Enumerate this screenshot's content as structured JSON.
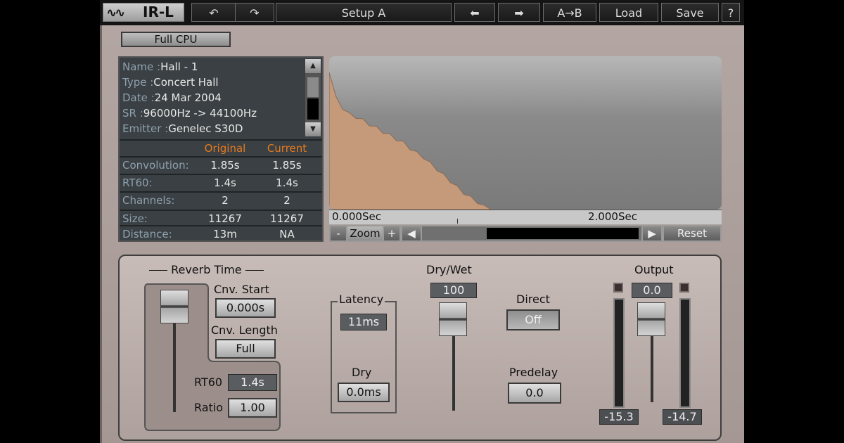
{
  "toolbar": {
    "logo_text": "IR-L",
    "setup_name": "Setup A",
    "ab_label": "A→B",
    "load_label": "Load",
    "save_label": "Save",
    "help_label": "?",
    "undo_icon": "undo-icon",
    "redo_icon": "redo-icon",
    "prev_icon": "arrow-left-icon",
    "next_icon": "arrow-right-icon"
  },
  "cpu_mode": "Full CPU",
  "ir_info": {
    "name_label": "Name :",
    "name": "Hall - 1",
    "type_label": "Type :",
    "type": "Concert Hall",
    "date_label": "Date :",
    "date": "24 Mar 2004",
    "sr_label": "SR :",
    "sr": "96000Hz -> 44100Hz",
    "emitter_label": "Emitter :",
    "emitter": "Genelec S30D"
  },
  "stats": {
    "col_original": "Original",
    "col_current": "Current",
    "rows": [
      {
        "label": "Convolution:",
        "original": "1.85s",
        "current": "1.85s"
      },
      {
        "label": "RT60:",
        "original": "1.4s",
        "current": "1.4s"
      },
      {
        "label": "Channels:",
        "original": "2",
        "current": "2"
      },
      {
        "label": "Size:",
        "original": "11267",
        "current": "11267"
      },
      {
        "label": "Distance:",
        "original": "13m",
        "current": "NA"
      }
    ]
  },
  "graph": {
    "axis_start": "0.000Sec",
    "axis_mid": "2.000Sec",
    "zoom_minus": "-",
    "zoom_label": "Zoom",
    "zoom_plus": "+",
    "reset_label": "Reset",
    "fill_color": "#c49a7a",
    "envelope": [
      0.92,
      0.75,
      0.68,
      0.64,
      0.62,
      0.6,
      0.57,
      0.55,
      0.52,
      0.5,
      0.47,
      0.45,
      0.41,
      0.38,
      0.35,
      0.31,
      0.27,
      0.23,
      0.19,
      0.15,
      0.11,
      0.08,
      0.05,
      0.02,
      0.0
    ]
  },
  "controls": {
    "reverb_time_label": "Reverb Time",
    "cnv_start_label": "Cnv. Start",
    "cnv_start": "0.000s",
    "cnv_length_label": "Cnv. Length",
    "cnv_length": "Full",
    "rt60_label": "RT60",
    "rt60": "1.4s",
    "ratio_label": "Ratio",
    "ratio": "1.00",
    "latency_label": "Latency",
    "latency": "11ms",
    "dry_label": "Dry",
    "dry": "0.0ms",
    "drywet_label": "Dry/Wet",
    "drywet": "100",
    "direct_label": "Direct",
    "direct": "Off",
    "predelay_label": "Predelay",
    "predelay": "0.0",
    "output_label": "Output",
    "output": "0.0",
    "meter_left": "-15.3",
    "meter_right": "-14.7"
  }
}
